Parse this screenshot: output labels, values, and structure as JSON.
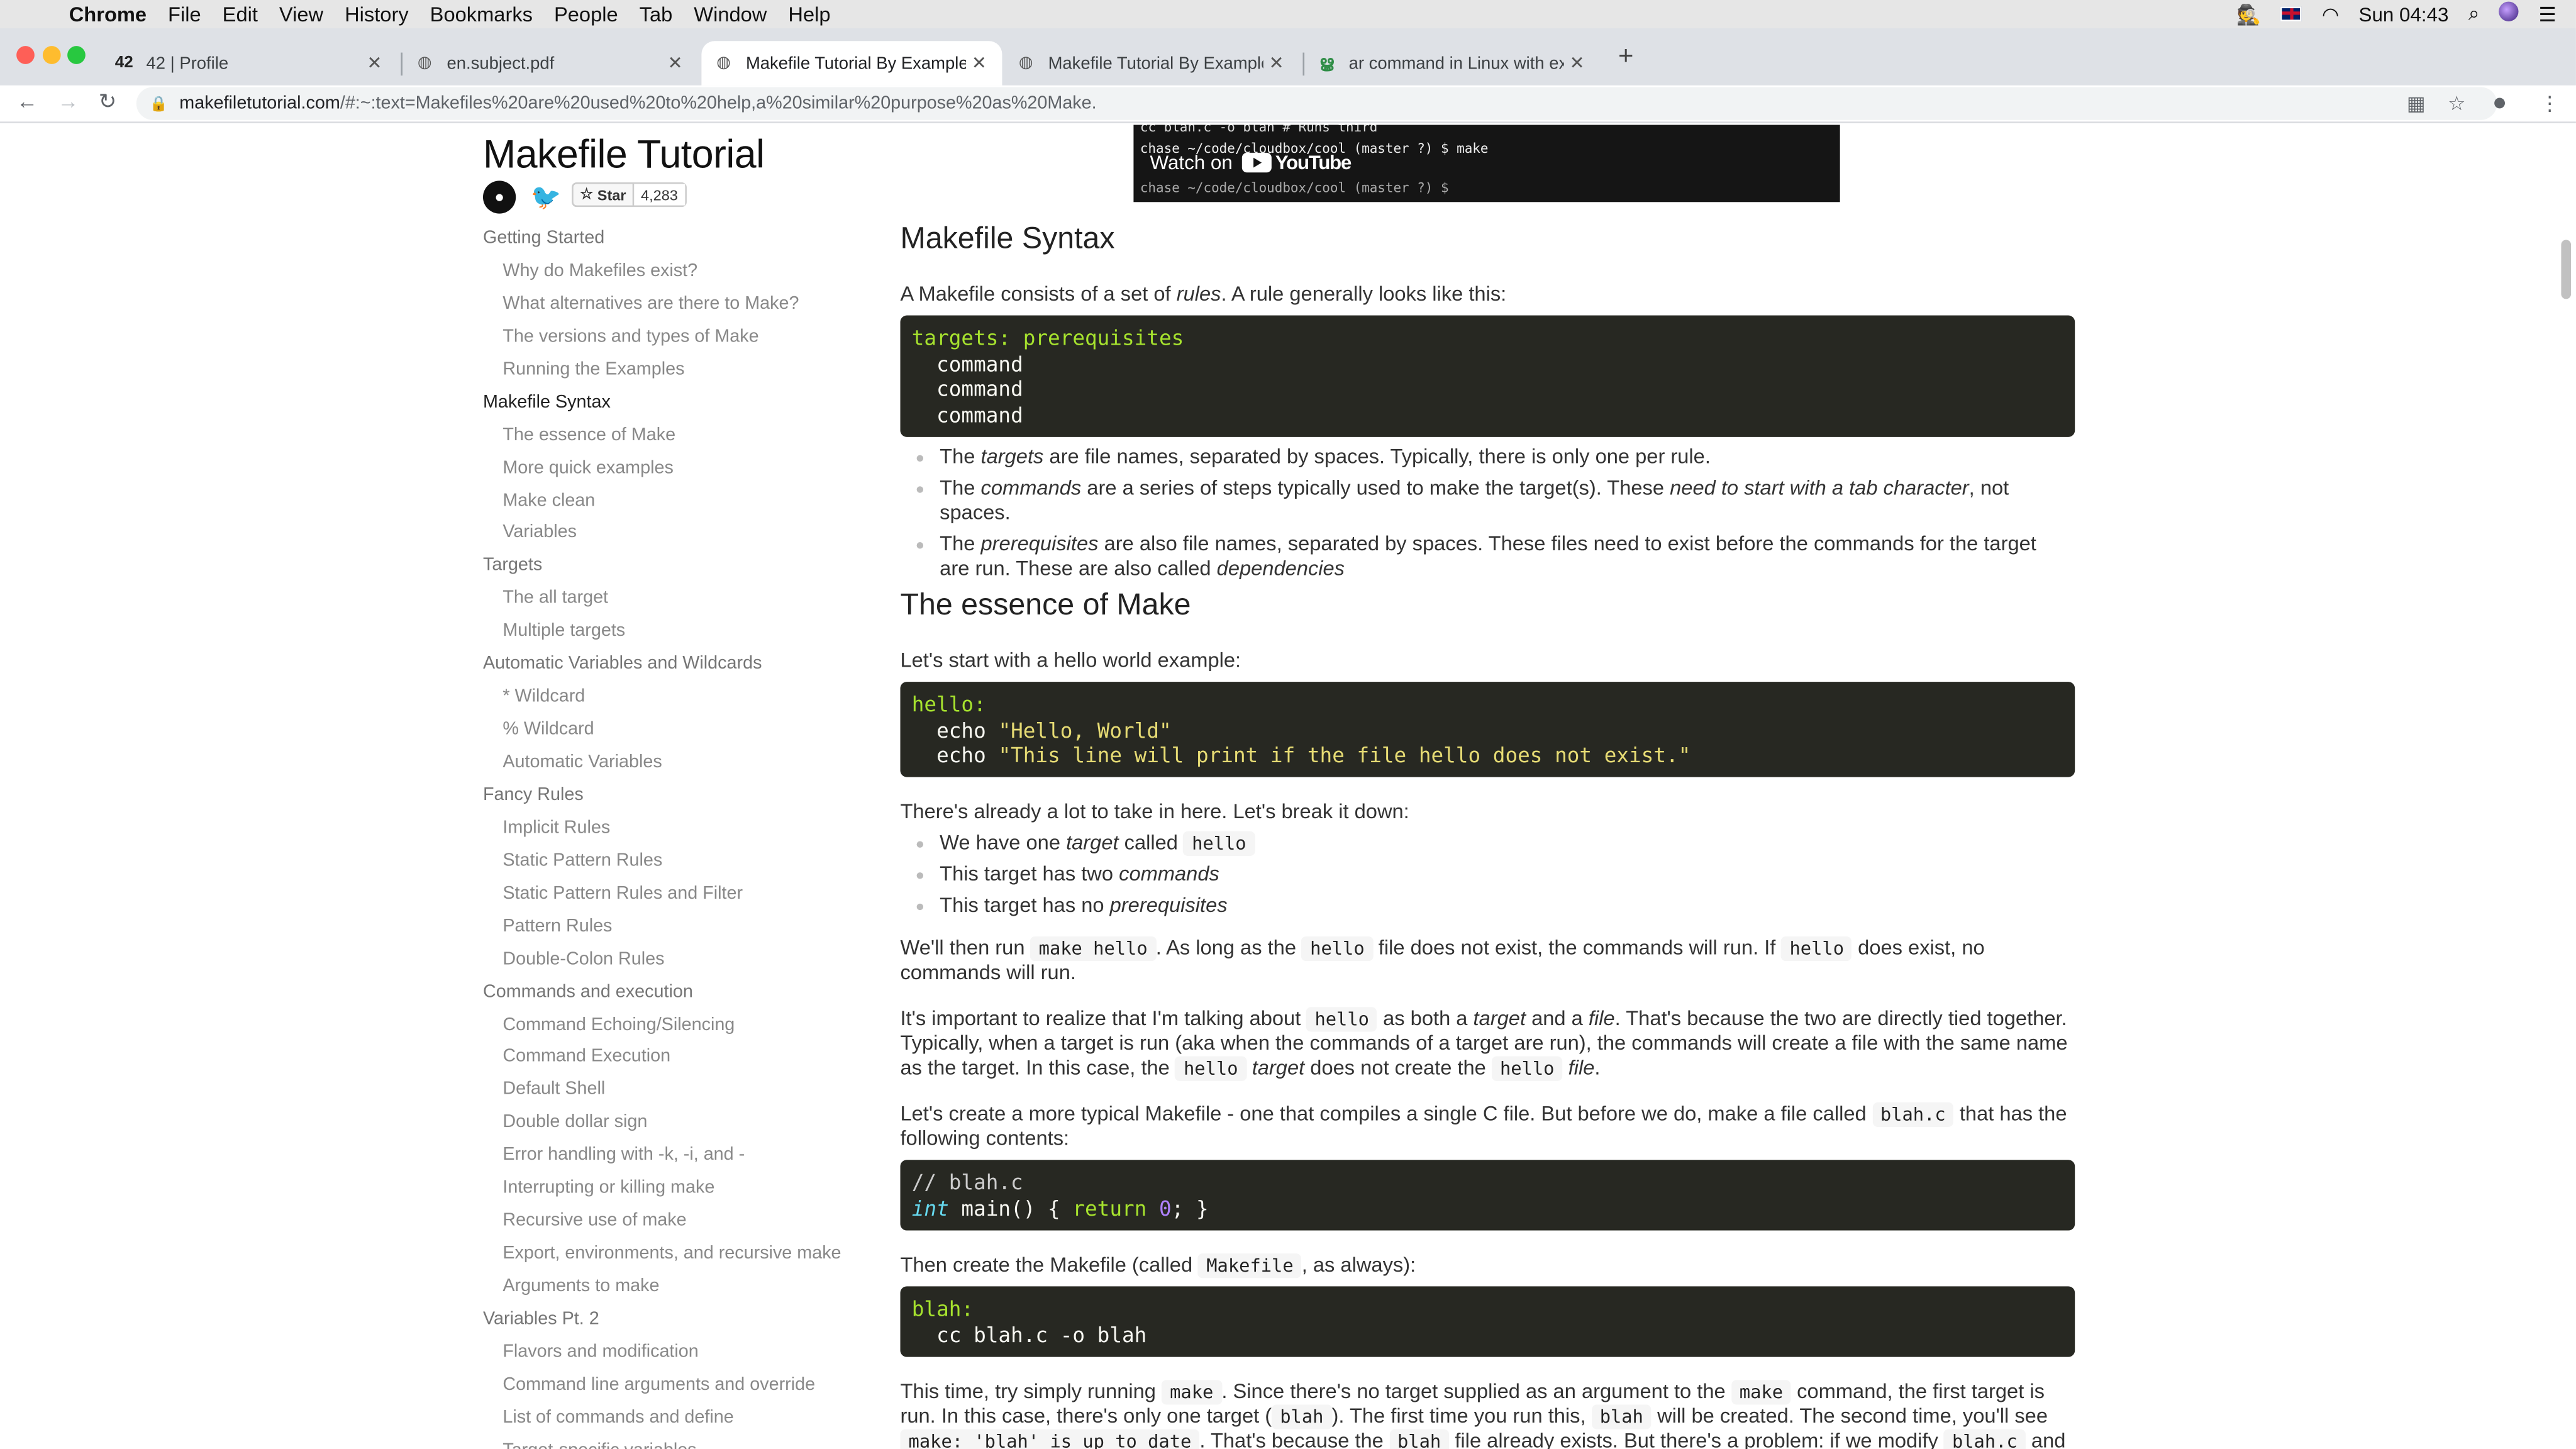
{
  "menubar": {
    "app": "Chrome",
    "items": [
      "File",
      "Edit",
      "View",
      "History",
      "Bookmarks",
      "People",
      "Tab",
      "Window",
      "Help"
    ],
    "clock": "Sun 04:43"
  },
  "tabs": [
    {
      "title": "42 | Profile"
    },
    {
      "title": "en.subject.pdf"
    },
    {
      "title": "Makefile Tutorial By Example"
    },
    {
      "title": "Makefile Tutorial By Example"
    },
    {
      "title": "ar command in Linux with exam"
    }
  ],
  "address": {
    "host": "makefiletutorial.com",
    "rest": "/#:~:text=Makefiles%20are%20used%20to%20help,a%20similar%20purpose%20as%20Make."
  },
  "site": {
    "title": "Makefile Tutorial",
    "star_label": "Star",
    "star_count": "4,283"
  },
  "nav": [
    {
      "t": "Getting Started",
      "lvl": "sec"
    },
    {
      "t": "Why do Makefiles exist?",
      "lvl": "sub"
    },
    {
      "t": "What alternatives are there to Make?",
      "lvl": "sub"
    },
    {
      "t": "The versions and types of Make",
      "lvl": "sub"
    },
    {
      "t": "Running the Examples",
      "lvl": "sub"
    },
    {
      "t": "Makefile Syntax",
      "lvl": "cur"
    },
    {
      "t": "The essence of Make",
      "lvl": "sub"
    },
    {
      "t": "More quick examples",
      "lvl": "sub"
    },
    {
      "t": "Make clean",
      "lvl": "sub"
    },
    {
      "t": "Variables",
      "lvl": "sub"
    },
    {
      "t": "Targets",
      "lvl": "sec"
    },
    {
      "t": "The all target",
      "lvl": "sub"
    },
    {
      "t": "Multiple targets",
      "lvl": "sub"
    },
    {
      "t": "Automatic Variables and Wildcards",
      "lvl": "sec"
    },
    {
      "t": "* Wildcard",
      "lvl": "sub"
    },
    {
      "t": "% Wildcard",
      "lvl": "sub"
    },
    {
      "t": "Automatic Variables",
      "lvl": "sub"
    },
    {
      "t": "Fancy Rules",
      "lvl": "sec"
    },
    {
      "t": "Implicit Rules",
      "lvl": "sub"
    },
    {
      "t": "Static Pattern Rules",
      "lvl": "sub"
    },
    {
      "t": "Static Pattern Rules and Filter",
      "lvl": "sub"
    },
    {
      "t": "Pattern Rules",
      "lvl": "sub"
    },
    {
      "t": "Double-Colon Rules",
      "lvl": "sub"
    },
    {
      "t": "Commands and execution",
      "lvl": "sec"
    },
    {
      "t": "Command Echoing/Silencing",
      "lvl": "sub"
    },
    {
      "t": "Command Execution",
      "lvl": "sub"
    },
    {
      "t": "Default Shell",
      "lvl": "sub"
    },
    {
      "t": "Double dollar sign",
      "lvl": "sub"
    },
    {
      "t": "Error handling with -k, -i, and -",
      "lvl": "sub"
    },
    {
      "t": "Interrupting or killing make",
      "lvl": "sub"
    },
    {
      "t": "Recursive use of make",
      "lvl": "sub"
    },
    {
      "t": "Export, environments, and recursive make",
      "lvl": "sub"
    },
    {
      "t": "Arguments to make",
      "lvl": "sub"
    },
    {
      "t": "Variables Pt. 2",
      "lvl": "sec"
    },
    {
      "t": "Flavors and modification",
      "lvl": "sub"
    },
    {
      "t": "Command line arguments and override",
      "lvl": "sub"
    },
    {
      "t": "List of commands and define",
      "lvl": "sub"
    },
    {
      "t": "Target-specific variables",
      "lvl": "sub"
    }
  ],
  "video": {
    "term1": "cc blah.c -o blah # Runs third",
    "term2": "chase ~/code/cloudbox/cool (master ?) $ make",
    "term3": "chase ~/code/cloudbox/cool (master ?) $",
    "watch_on": "Watch on",
    "youtube": "YouTube"
  },
  "content": {
    "h_syntax": "Makefile Syntax",
    "p_syntax_1": "A Makefile consists of a set of ",
    "p_syntax_rules": "rules",
    "p_syntax_2": ". A rule generally looks like this:",
    "code1_l1": "targets: prerequisites",
    "code1_cmd": "command",
    "b1_a": "The ",
    "b1_i": "targets",
    "b1_b": " are file names, separated by spaces. Typically, there is only one per rule.",
    "b2_a": "The ",
    "b2_i": "commands",
    "b2_b": " are a series of steps typically used to make the target(s). These ",
    "b2_i2": "need to start with a tab character",
    "b2_c": ", not spaces.",
    "b3_a": "The ",
    "b3_i": "prerequisites",
    "b3_b": " are also file names, separated by spaces. These files need to exist before the commands for the target are run. These are also called ",
    "b3_i2": "dependencies",
    "h_essence": "The essence of Make",
    "p_hello": "Let's start with a hello world example:",
    "code2_l1": "hello:",
    "code2_echo": "echo",
    "code2_s1": "\"Hello, World\"",
    "code2_s2": "\"This line will print if the file hello does not exist.\"",
    "p_lot": "There's already a lot to take in here. Let's break it down:",
    "c1_a": "We have one ",
    "c1_i": "target",
    "c1_b": " called ",
    "c1_code": "hello",
    "c2_a": "This target has two ",
    "c2_i": "commands",
    "c3_a": "This target has no ",
    "c3_i": "prerequisites",
    "p_run_a": "We'll then run ",
    "p_run_c1": "make hello",
    "p_run_b": ". As long as the ",
    "p_run_c2": "hello",
    "p_run_c": " file does not exist, the commands will run. If ",
    "p_run_c3": "hello",
    "p_run_d": " does exist, no commands will run.",
    "p_imp_a": "It's important to realize that I'm talking about ",
    "p_imp_c1": "hello",
    "p_imp_b": " as both a ",
    "p_imp_i1": "target",
    "p_imp_c": " and a ",
    "p_imp_i2": "file",
    "p_imp_d": ". That's because the two are directly tied together. Typically, when a target is run (aka when the commands of a target are run), the commands will create a file with the same name as the target. In this case, the ",
    "p_imp_c2": "hello",
    "p_imp_i3": "target",
    "p_imp_e": " does not create the ",
    "p_imp_c3": "hello",
    "p_imp_i4": "file",
    "p_imp_f": ".",
    "p_typ_a": "Let's create a more typical Makefile - one that compiles a single C file. But before we do, make a file called ",
    "p_typ_c": "blah.c",
    "p_typ_b": " that has the following contents:",
    "code3_cm": "// blah.c",
    "code3_int": "int",
    "code3_main": " main() { ",
    "code3_ret": "return",
    "code3_zero": "0",
    "code3_end": "; }",
    "p_then_a": "Then create the Makefile (called ",
    "p_then_c": "Makefile",
    "p_then_b": ", as always):",
    "code4_l1": "blah:",
    "code4_l2": "cc blah.c -o blah",
    "p_time_a": "This time, try simply running ",
    "p_time_c1": "make",
    "p_time_b": ". Since there's no target supplied as an argument to the ",
    "p_time_c2": "make",
    "p_time_c": " command, the first target is run. In this case, there's only one target (",
    "p_time_c3": "blah",
    "p_time_d": "). The first time you run this, ",
    "p_time_c4": "blah",
    "p_time_e": " will be created. The second time, you'll see ",
    "p_time_c5": "make: 'blah' is up to date",
    "p_time_f": ". That's because the ",
    "p_time_c6": "blah",
    "p_time_g": " file already exists. But there's a problem: if we modify ",
    "p_time_c7": "blah.c",
    "p_time_h": " and"
  }
}
